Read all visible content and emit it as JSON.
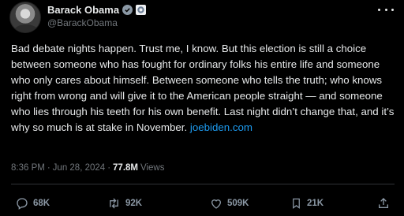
{
  "tweet": {
    "author_name": "Barack Obama",
    "handle": "@BarackObama",
    "body": "Bad debate nights happen. Trust me, I know. But this election is still a choice between someone who has fought for ordinary folks his entire life and someone who only cares about himself. Between someone who tells the truth; who knows right from wrong and will give it to the American people straight — and someone who lies through his teeth for his own benefit. Last night didn’t change that, and it’s why so much is at stake in November.",
    "link_text": "joebiden.com",
    "time": "8:36 PM",
    "separator": "·",
    "date": "Jun 28, 2024",
    "views_count": "77.8M",
    "views_label": "Views"
  },
  "actions": {
    "replies": "68K",
    "reposts": "92K",
    "likes": "509K",
    "bookmarks": "21K"
  },
  "colors": {
    "background": "#000000",
    "text": "#e7e9ea",
    "secondary": "#71767b",
    "link": "#1d9bf0",
    "divider": "#2f3336"
  },
  "icons": [
    "verified-badge-icon",
    "government-badge-icon",
    "more-icon",
    "reply-icon",
    "repost-icon",
    "like-icon",
    "bookmark-icon",
    "share-icon"
  ]
}
